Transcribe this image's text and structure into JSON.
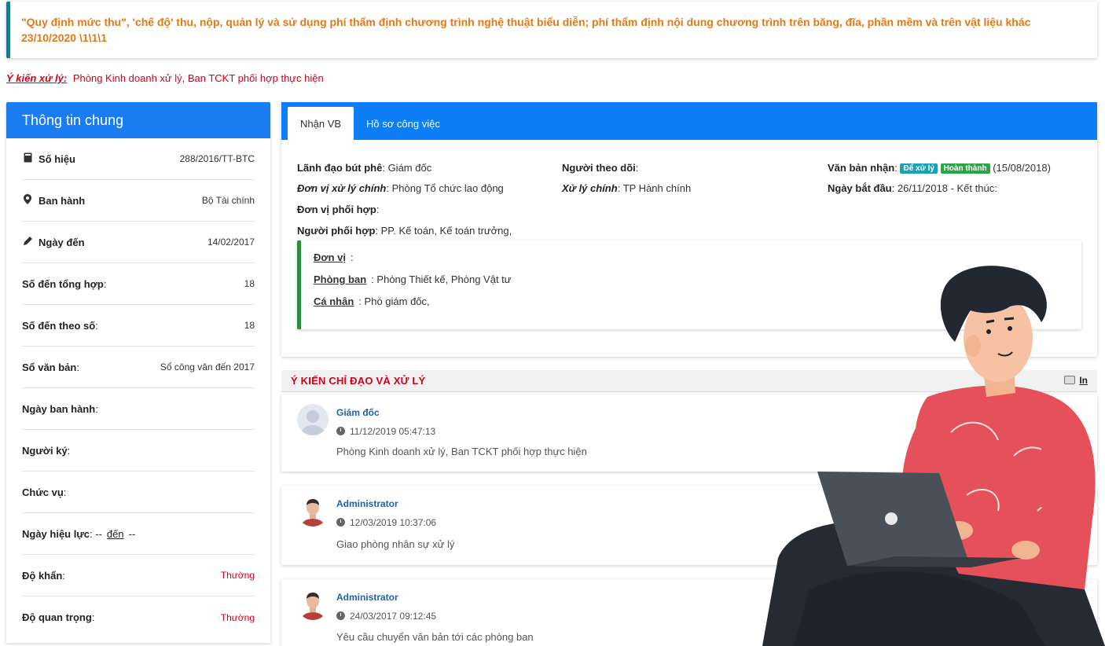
{
  "header": {
    "title": "\"Quy định mức thu\", 'chế độ' thu, nộp, quản lý và sử dụng phí thẩm định chương trình nghệ thuật biểu diễn; phí thẩm định nội dung chương trình trên băng, đĩa, phần mềm và trên vật liệu khác 23/10/2020 \\1\\1\\1"
  },
  "opinion": {
    "label": "Ý kiến xử lý:",
    "text": "Phòng Kinh doanh xử lý, Ban TCKT phối hợp thực hiện"
  },
  "general": {
    "heading": "Thông tin chung",
    "rows": [
      {
        "label": "Số hiệu",
        "value": "288/2016/TT-BTC",
        "icon": "book-icon"
      },
      {
        "label": "Ban hành",
        "value": "Bộ Tài chính",
        "icon": "map-marker-icon"
      },
      {
        "label": "Ngày đến",
        "value": "14/02/2017",
        "icon": "pencil-icon"
      },
      {
        "label": "Số đến tổng hợp",
        "value": "18"
      },
      {
        "label": "Số đến theo số",
        "value": "18"
      },
      {
        "label": "Sổ văn bản",
        "value": "Sổ công văn đến 2017"
      },
      {
        "label": "Ngày ban hành",
        "value": ""
      },
      {
        "label": "Người ký",
        "value": ""
      },
      {
        "label": "Chức vụ",
        "value": ""
      },
      {
        "label": "Ngày hiệu lực",
        "value": ""
      },
      {
        "label": "Độ khẩn",
        "value": "Thường"
      },
      {
        "label": "Độ quan trọng",
        "value": "Thường"
      }
    ],
    "effective_from": "--",
    "effective_sep": "đến",
    "effective_to": "--"
  },
  "tabs": [
    {
      "label": "Nhận VB",
      "active": true
    },
    {
      "label": "Hồ sơ công việc",
      "active": false
    }
  ],
  "details": {
    "leader_label": "Lãnh đạo bút phê",
    "leader_value": "Giám đốc",
    "unit_label": "Đơn vị xử lý chính",
    "unit_value": "Phòng Tổ chức lao động",
    "coop_unit_label": "Đơn vị phối hợp",
    "coop_person_label": "Người phối hợp",
    "coop_person_value": "PP. Kế toán, Kế toán trưởng,",
    "follower_label": "Người theo dõi",
    "main_handler_label": "Xử lý chính",
    "main_handler_value": "TP Hành chính",
    "received_label": "Văn bản nhận",
    "badge_process": "Để xử lý",
    "badge_done": "Hoàn thành",
    "received_date": "(15/08/2018)",
    "start_label": "Ngày bắt đầu",
    "start_value": "26/11/2018 - Kết thúc:"
  },
  "coop": {
    "unit_label": "Đơn vị",
    "unit_value": "",
    "dept_label": "Phòng ban",
    "dept_value": "Phòng Thiết kế, Phòng Vật tư",
    "person_label": "Cá nhân",
    "person_value": "Phó giám đốc,"
  },
  "comments_section": {
    "title": "Ý KIẾN CHỈ ĐẠO VÀ XỬ LÝ",
    "print_label": "In"
  },
  "comments": [
    {
      "author": "Giám đốc",
      "time": "11/12/2019 05:47:13",
      "text": "Phòng Kinh doanh xử lý, Ban TCKT phối hợp thực hiện"
    },
    {
      "author": "Administrator",
      "time": "12/03/2019 10:37:06",
      "text": "Giao phòng nhân sự xử lý"
    },
    {
      "author": "Administrator",
      "time": "24/03/2017 09:12:45",
      "text": "Yêu cầu chuyển văn bản tới các phòng ban"
    }
  ],
  "colors": {
    "primary": "#1a7ef2",
    "title_orange": "#e07a19",
    "alert_red": "#d0021b",
    "link_blue": "#1c62ae"
  }
}
